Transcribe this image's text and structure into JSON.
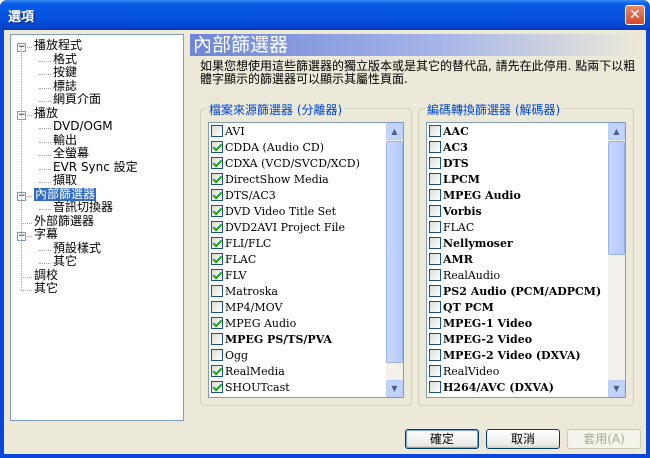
{
  "window": {
    "title": "選項",
    "close_icon": "close-icon"
  },
  "tree": [
    {
      "label": "播放程式",
      "level": 0,
      "expanded": true
    },
    {
      "label": "格式",
      "level": 1
    },
    {
      "label": "按鍵",
      "level": 1
    },
    {
      "label": "標誌",
      "level": 1
    },
    {
      "label": "網頁介面",
      "level": 1
    },
    {
      "label": "播放",
      "level": 0,
      "expanded": true
    },
    {
      "label": "DVD/OGM",
      "level": 1
    },
    {
      "label": "輸出",
      "level": 1
    },
    {
      "label": "全螢幕",
      "level": 1
    },
    {
      "label": "EVR Sync 設定",
      "level": 1
    },
    {
      "label": "擷取",
      "level": 1
    },
    {
      "label": "內部篩選器",
      "level": 0,
      "expanded": true,
      "selected": true
    },
    {
      "label": "音訊切換器",
      "level": 1
    },
    {
      "label": "外部篩選器",
      "level": 0
    },
    {
      "label": "字幕",
      "level": 0,
      "expanded": true
    },
    {
      "label": "預設樣式",
      "level": 1
    },
    {
      "label": "其它",
      "level": 1
    },
    {
      "label": "調校",
      "level": 0
    },
    {
      "label": "其它",
      "level": 0
    }
  ],
  "page": {
    "header": "內部篩選器",
    "description": "如果您想使用這些篩選器的獨立版本或是其它的替代品, 請先在此停用. 點兩下以粗體字顯示的篩選器可以顯示其屬性頁面."
  },
  "source_filters": {
    "label": "檔案來源篩選器 (分離器)",
    "items": [
      {
        "label": "AVI",
        "checked": false,
        "bold": false
      },
      {
        "label": "CDDA (Audio CD)",
        "checked": true,
        "bold": false
      },
      {
        "label": "CDXA (VCD/SVCD/XCD)",
        "checked": true,
        "bold": false
      },
      {
        "label": "DirectShow Media",
        "checked": true,
        "bold": false
      },
      {
        "label": "DTS/AC3",
        "checked": true,
        "bold": false
      },
      {
        "label": "DVD Video Title Set",
        "checked": true,
        "bold": false
      },
      {
        "label": "DVD2AVI Project File",
        "checked": true,
        "bold": false
      },
      {
        "label": "FLI/FLC",
        "checked": true,
        "bold": false
      },
      {
        "label": "FLAC",
        "checked": true,
        "bold": false
      },
      {
        "label": "FLV",
        "checked": true,
        "bold": false
      },
      {
        "label": "Matroska",
        "checked": false,
        "bold": false
      },
      {
        "label": "MP4/MOV",
        "checked": false,
        "bold": false
      },
      {
        "label": "MPEG Audio",
        "checked": true,
        "bold": false
      },
      {
        "label": "MPEG PS/TS/PVA",
        "checked": false,
        "bold": true
      },
      {
        "label": "Ogg",
        "checked": false,
        "bold": false
      },
      {
        "label": "RealMedia",
        "checked": true,
        "bold": false
      },
      {
        "label": "SHOUTcast",
        "checked": true,
        "bold": false
      }
    ]
  },
  "transform_filters": {
    "label": "編碼轉換篩選器 (解碼器)",
    "items": [
      {
        "label": "AAC",
        "checked": false,
        "bold": true
      },
      {
        "label": "AC3",
        "checked": false,
        "bold": true
      },
      {
        "label": "DTS",
        "checked": false,
        "bold": true
      },
      {
        "label": "LPCM",
        "checked": false,
        "bold": true
      },
      {
        "label": "MPEG Audio",
        "checked": false,
        "bold": true
      },
      {
        "label": "Vorbis",
        "checked": false,
        "bold": true
      },
      {
        "label": "FLAC",
        "checked": false,
        "bold": false
      },
      {
        "label": "Nellymoser",
        "checked": false,
        "bold": true
      },
      {
        "label": "AMR",
        "checked": false,
        "bold": true
      },
      {
        "label": "RealAudio",
        "checked": false,
        "bold": false
      },
      {
        "label": "PS2 Audio (PCM/ADPCM)",
        "checked": false,
        "bold": true
      },
      {
        "label": "QT PCM",
        "checked": false,
        "bold": true
      },
      {
        "label": "MPEG-1 Video",
        "checked": false,
        "bold": true
      },
      {
        "label": "MPEG-2 Video",
        "checked": false,
        "bold": true
      },
      {
        "label": "MPEG-2 Video (DXVA)",
        "checked": false,
        "bold": true
      },
      {
        "label": "RealVideo",
        "checked": false,
        "bold": false
      },
      {
        "label": "H264/AVC (DXVA)",
        "checked": false,
        "bold": true
      }
    ]
  },
  "buttons": {
    "ok": "確定",
    "cancel": "取消",
    "apply": "套用(A)"
  }
}
